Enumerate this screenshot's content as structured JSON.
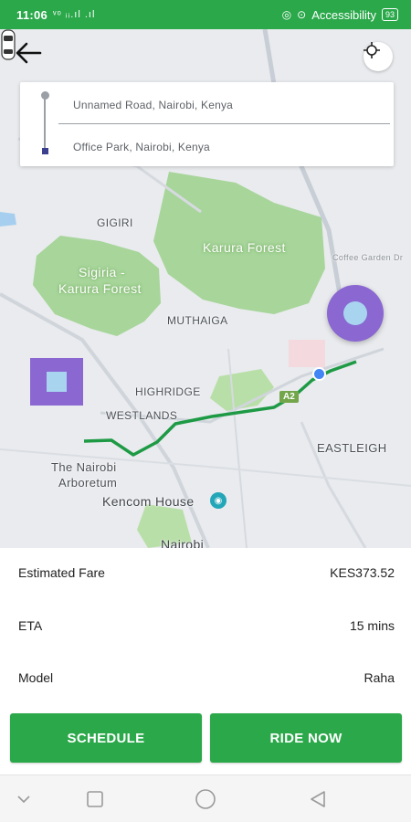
{
  "status_bar": {
    "time": "11:06",
    "signal": "ᵛᵒ ᵢᵢ.ıl .ıl",
    "accessibility": "Accessibility",
    "battery": "93"
  },
  "route": {
    "from": "Unnamed Road, Nairobi, Kenya",
    "to": "Office Park, Nairobi, Kenya"
  },
  "map_labels": {
    "gigiri": "GIGIRI",
    "karura_forest": "Karura Forest",
    "sigiria_line1": "Sigiria -",
    "sigiria_line2": "Karura Forest",
    "muthaiga": "MUTHAIGA",
    "coffee_garden": "Coffee Garden Dr",
    "highridge": "HIGHRIDGE",
    "westlands": "WESTLANDS",
    "eastleigh": "EASTLEIGH",
    "arboretum_line1": "The Nairobi",
    "arboretum_line2": "Arboretum",
    "kencom": "Kencom House",
    "nairobi": "Nairobi",
    "road_a2": "A2"
  },
  "info": {
    "fare_label": "Estimated Fare",
    "fare_value": "KES373.52",
    "eta_label": "ETA",
    "eta_value": "15 mins",
    "model_label": "Model",
    "model_value": "Raha"
  },
  "buttons": {
    "schedule": "SCHEDULE",
    "ride_now": "RIDE NOW"
  },
  "colors": {
    "brand_green": "#2aa84a",
    "marker_purple": "#8a67d1",
    "marker_inner": "#a9d4f0",
    "route_green": "#1e9a45"
  },
  "icons": {
    "back": "arrow-left-icon",
    "locate": "crosshair-icon",
    "car": "car-icon",
    "my_location": "blue-dot-icon"
  }
}
